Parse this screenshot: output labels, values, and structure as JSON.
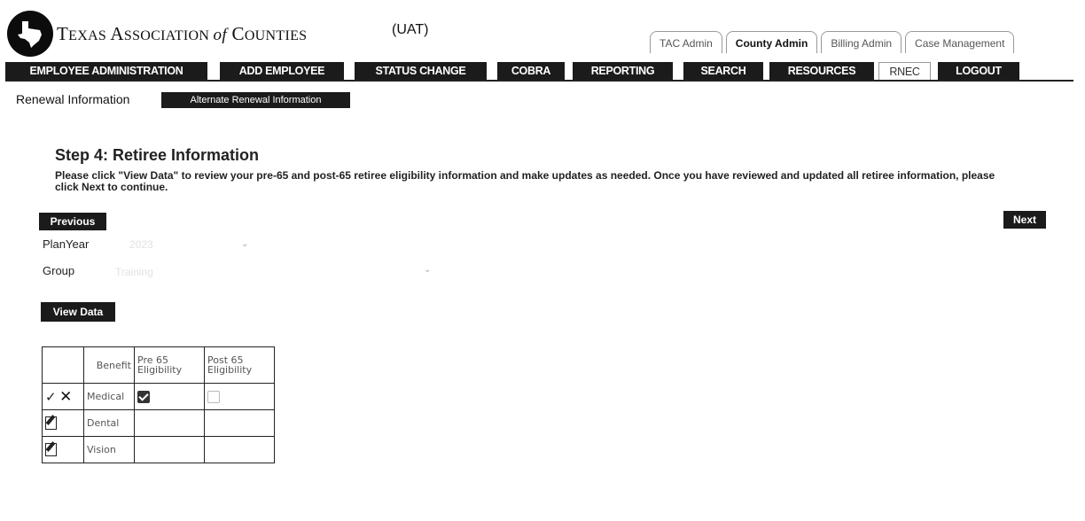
{
  "header": {
    "org_name": {
      "t1": "T",
      "t2": "EXAS ",
      "a1": "A",
      "a2": "SSOCIATION ",
      "of": "of",
      "c1": "C",
      "c2": "OUNTIES"
    },
    "env": "(UAT)",
    "tabs": [
      {
        "label": "TAC Admin",
        "active": false
      },
      {
        "label": "County Admin",
        "active": true
      },
      {
        "label": "Billing Admin",
        "active": false
      },
      {
        "label": "Case Management",
        "active": false
      }
    ]
  },
  "nav": {
    "items": [
      {
        "label": "EMPLOYEE ADMINISTRATION"
      },
      {
        "label": "ADD EMPLOYEE"
      },
      {
        "label": "STATUS CHANGE"
      },
      {
        "label": "COBRA"
      },
      {
        "label": "REPORTING"
      },
      {
        "label": "SEARCH"
      },
      {
        "label": "RESOURCES"
      },
      {
        "label": "RNEC",
        "active": true
      },
      {
        "label": "LOGOUT"
      }
    ]
  },
  "subnav": {
    "renewal_info": "Renewal Information",
    "alt_renewal": "Alternate Renewal Information"
  },
  "step": {
    "title": "Step 4: Retiree Information",
    "instructions": "Please click \"View Data\" to review your pre-65 and post-65 retiree eligibility information and make updates as needed. Once you have reviewed and updated all retiree information, please click Next to continue."
  },
  "buttons": {
    "previous": "Previous",
    "next": "Next",
    "view_data": "View Data"
  },
  "form": {
    "planyear_label": "PlanYear",
    "planyear_value": "2023",
    "group_label": "Group",
    "group_value": "Training"
  },
  "table": {
    "headers": {
      "benefit": "Benefit",
      "pre65_l1": "Pre 65",
      "pre65_l2": "Eligibility",
      "post65_l1": "Post 65",
      "post65_l2": "Eligibility"
    },
    "rows": [
      {
        "benefit": "Medical",
        "pre65": true,
        "post65": false,
        "editing": true
      },
      {
        "benefit": "Dental",
        "editing": false
      },
      {
        "benefit": "Vision",
        "editing": false
      }
    ]
  },
  "colors": {
    "nav_bg": "#1b1b1b",
    "nav_text": "#ffffff"
  }
}
